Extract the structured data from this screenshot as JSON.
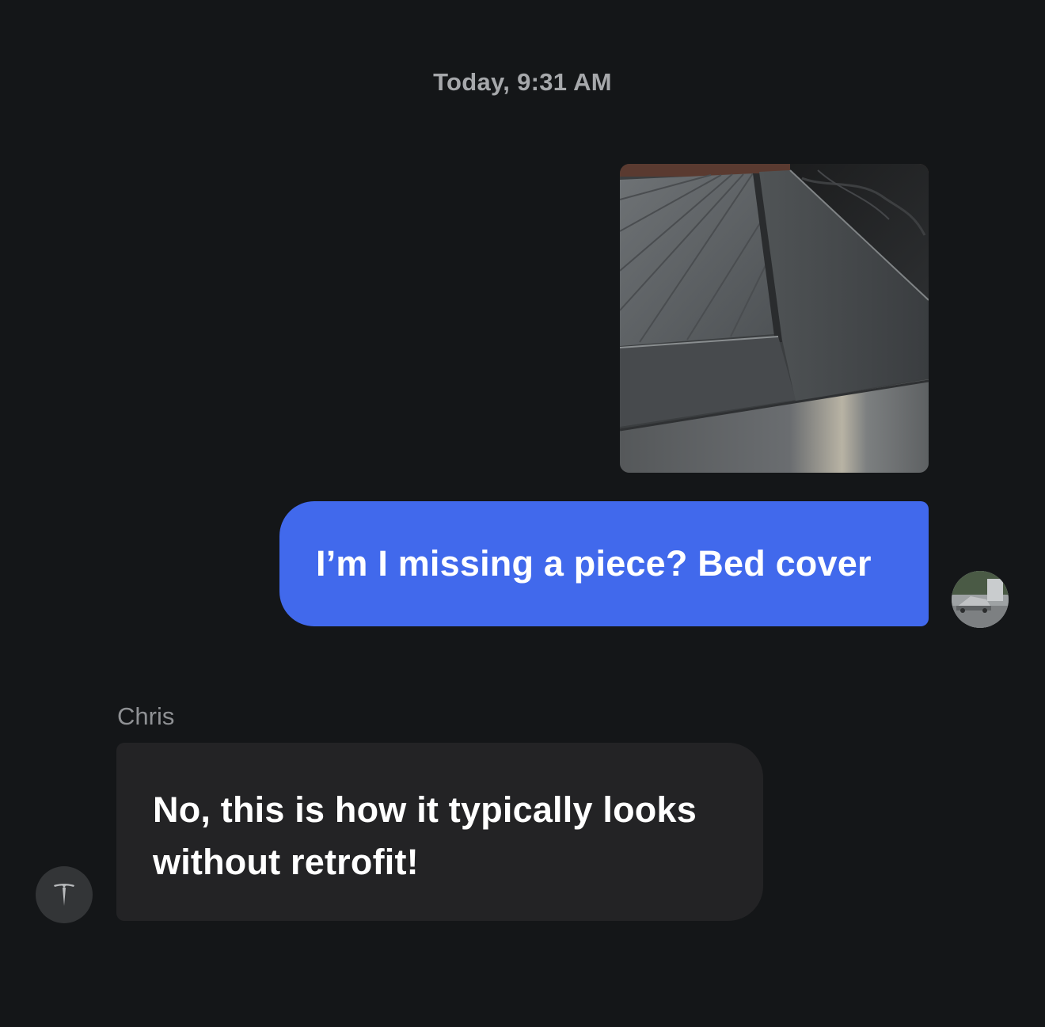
{
  "conversation": {
    "timestamp": "Today, 9:31 AM",
    "messages": [
      {
        "direction": "outgoing",
        "type": "image",
        "image_subject": "truck-bed-cover-photo"
      },
      {
        "direction": "outgoing",
        "type": "text",
        "text": "I’m I missing a piece? Bed cover",
        "avatar_icon": "user-avatar-car-photo"
      },
      {
        "direction": "incoming",
        "type": "text",
        "sender": "Chris",
        "text": "No, this is how it typically looks without retrofit!",
        "avatar_icon": "tesla-logo-icon"
      }
    ]
  },
  "colors": {
    "background": "#141618",
    "outgoing_bubble": "#4169ec",
    "incoming_bubble": "#232325",
    "timestamp_text": "#a6a8ab",
    "sender_text": "#8f9194"
  }
}
